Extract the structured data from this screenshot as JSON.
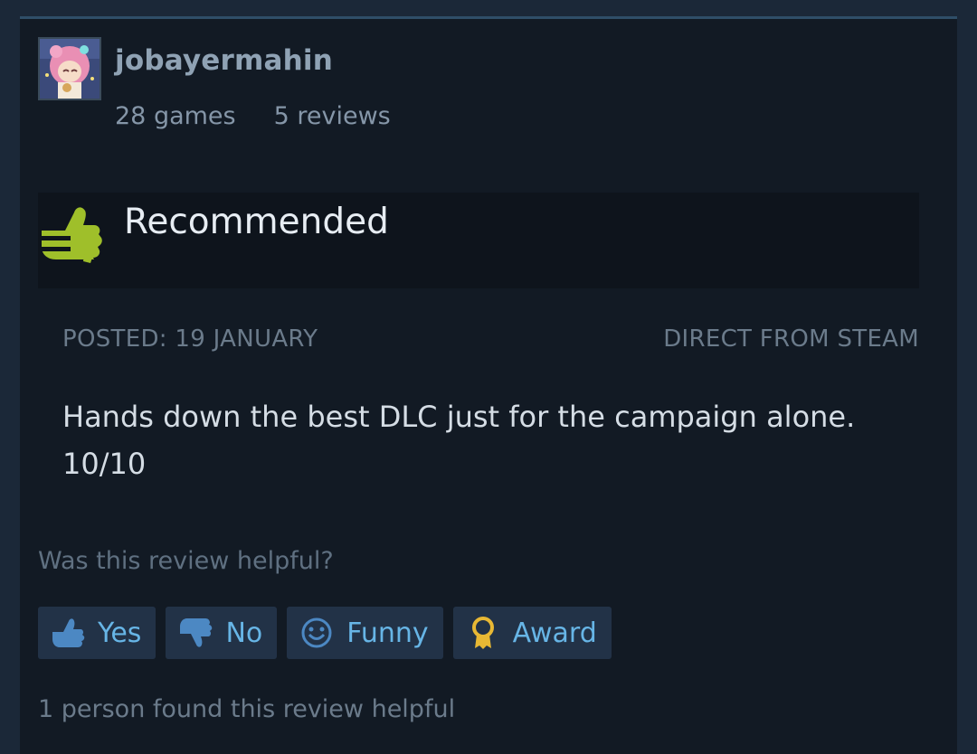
{
  "author": {
    "name": "jobayermahin",
    "games": "28 games",
    "reviews": "5 reviews"
  },
  "verdict": {
    "label": "Recommended",
    "icon": "thumbs-up-icon",
    "color": "#9fbf2a"
  },
  "meta": {
    "posted": "POSTED: 19 JANUARY",
    "source": "DIRECT FROM STEAM"
  },
  "review": {
    "text": "Hands down the best DLC just for the campaign alone. 10/10"
  },
  "helpful": {
    "question": "Was this review helpful?",
    "buttons": {
      "yes": "Yes",
      "no": "No",
      "funny": "Funny",
      "award": "Award"
    },
    "count_text": "1 person found this review helpful"
  },
  "colors": {
    "background": "#1b2838",
    "card": "#121a24",
    "button_bg": "#223247",
    "button_text": "#67b5e6",
    "award_icon": "#e8b834"
  }
}
